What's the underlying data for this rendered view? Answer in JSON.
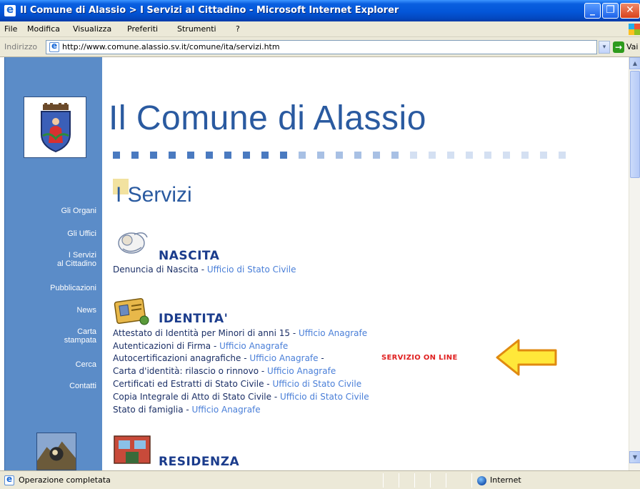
{
  "window": {
    "title": "Il Comune di Alassio > I Servizi al Cittadino - Microsoft Internet Explorer",
    "min_glyph": "_",
    "max_glyph": "❐",
    "close_glyph": "✕"
  },
  "menu": {
    "items": [
      "File",
      "Modifica",
      "Visualizza",
      "Preferiti",
      "Strumenti",
      "?"
    ]
  },
  "address": {
    "label": "Indirizzo",
    "url": "http://www.comune.alassio.sv.it/comune/ita/servizi.htm",
    "dropdown_glyph": "▾",
    "go_glyph": "→",
    "go_label": "Vai"
  },
  "sidebar": {
    "items": [
      "Gli Organi",
      "Gli Uffici",
      "I Servizi\nal Cittadino",
      "Pubblicazioni",
      "News",
      "Carta\nstampata",
      "Cerca",
      "Contatti"
    ]
  },
  "page": {
    "title": "Il Comune di Alassio",
    "section": "I Servizi",
    "separator": " - ",
    "dot_colors": [
      "#4a7ac0",
      "#a8c0e4",
      "#d4e0f2"
    ]
  },
  "categories": [
    {
      "title": "NASCITA",
      "entries": [
        {
          "text": "Denuncia di Nascita",
          "office": "Ufficio di Stato Civile"
        }
      ]
    },
    {
      "title": "IDENTITA'",
      "entries": [
        {
          "text": "Attestato di Identità per Minori di anni 15",
          "office": "Ufficio Anagrafe"
        },
        {
          "text": "Autenticazioni di Firma",
          "office": "Ufficio Anagrafe"
        },
        {
          "text": "Autocertificazioni anagrafiche",
          "office": "Ufficio Anagrafe"
        },
        {
          "text": "Carta d'identità: rilascio o rinnovo",
          "office": "Ufficio Anagrafe"
        },
        {
          "text": "Certificati ed Estratti di Stato Civile",
          "office": "Ufficio di Stato Civile"
        },
        {
          "text": "Copia Integrale di Atto di Stato Civile",
          "office": "Ufficio di Stato Civile"
        },
        {
          "text": "Stato di famiglia",
          "office": "Ufficio Anagrafe"
        }
      ],
      "online_badge": "SERVIZIO ON LINE"
    },
    {
      "title": "RESIDENZA",
      "entries": []
    }
  ],
  "scrollbar": {
    "up_glyph": "▲",
    "down_glyph": "▼"
  },
  "status": {
    "text": "Operazione completata",
    "zone": "Internet"
  },
  "colors": {
    "titlebar": "#0356d8",
    "sidebar": "#5b8cc8",
    "heading": "#2a5aa0",
    "category": "#1b3c8c",
    "link": "#4a7fd8",
    "online_badge": "#e02020",
    "arrow_fill": "#ffe83a",
    "arrow_stroke": "#e08a10"
  }
}
